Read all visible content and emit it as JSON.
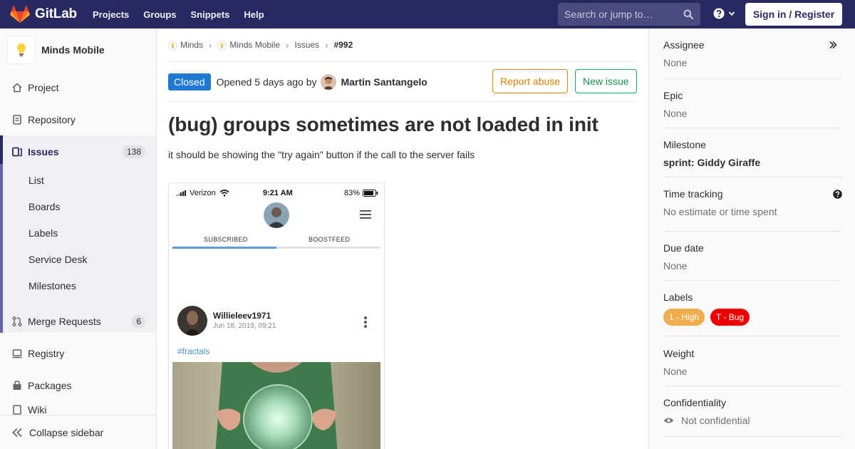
{
  "navbar": {
    "brand": "GitLab",
    "links": [
      "Projects",
      "Groups",
      "Snippets",
      "Help"
    ],
    "search_placeholder": "Search or jump to…",
    "signin": "Sign in / Register"
  },
  "sidebar": {
    "project_name": "Minds Mobile",
    "items": [
      {
        "label": "Project",
        "icon": "home-icon"
      },
      {
        "label": "Repository",
        "icon": "doc-icon"
      },
      {
        "label": "Issues",
        "icon": "issues-icon",
        "badge": "138"
      },
      {
        "label": "Merge Requests",
        "icon": "merge-icon",
        "badge": "6"
      },
      {
        "label": "Registry",
        "icon": "registry-icon"
      },
      {
        "label": "Packages",
        "icon": "package-icon"
      },
      {
        "label": "Wiki",
        "icon": "book-icon"
      }
    ],
    "sub_items": [
      "List",
      "Boards",
      "Labels",
      "Service Desk",
      "Milestones"
    ],
    "collapse": "Collapse sidebar"
  },
  "breadcrumb": [
    "Minds",
    "Minds Mobile",
    "Issues",
    "#992"
  ],
  "issue": {
    "status": "Closed",
    "opened": "Opened 5 days ago by",
    "author": "Martin Santangelo",
    "report_abuse": "Report abuse",
    "new_issue": "New issue",
    "title": "(bug) groups sometimes are not loaded in init",
    "description": "it should be showing the \"try again\" button if the call to the server fails"
  },
  "screenshot": {
    "carrier": "Verizon",
    "time": "9:21 AM",
    "battery": "83%",
    "tab_subscribed": "SUBSCRIBED",
    "tab_boostfeed": "BOOSTFEED",
    "username": "Willieleev1971",
    "post_date": "Jun 18, 2019, 09:21",
    "hashtag": "#fractals"
  },
  "right_sidebar": {
    "assignee": {
      "title": "Assignee",
      "value": "None"
    },
    "epic": {
      "title": "Epic",
      "value": "None"
    },
    "milestone": {
      "title": "Milestone",
      "value": "sprint: Giddy Giraffe"
    },
    "time_tracking": {
      "title": "Time tracking",
      "value": "No estimate or time spent"
    },
    "due_date": {
      "title": "Due date",
      "value": "None"
    },
    "labels": {
      "title": "Labels",
      "items": [
        {
          "text": "1 - High",
          "color": "#f0ad4e"
        },
        {
          "text": "T - Bug",
          "color": "#ee0000"
        }
      ]
    },
    "weight": {
      "title": "Weight",
      "value": "None"
    },
    "confidentiality": {
      "title": "Confidentiality",
      "value": "Not confidential"
    }
  },
  "colors": {
    "navbar": "#292961",
    "closed_badge": "#1f78d1",
    "abuse_btn": "#db8b0b",
    "new_issue_btn": "#1aaa55"
  }
}
